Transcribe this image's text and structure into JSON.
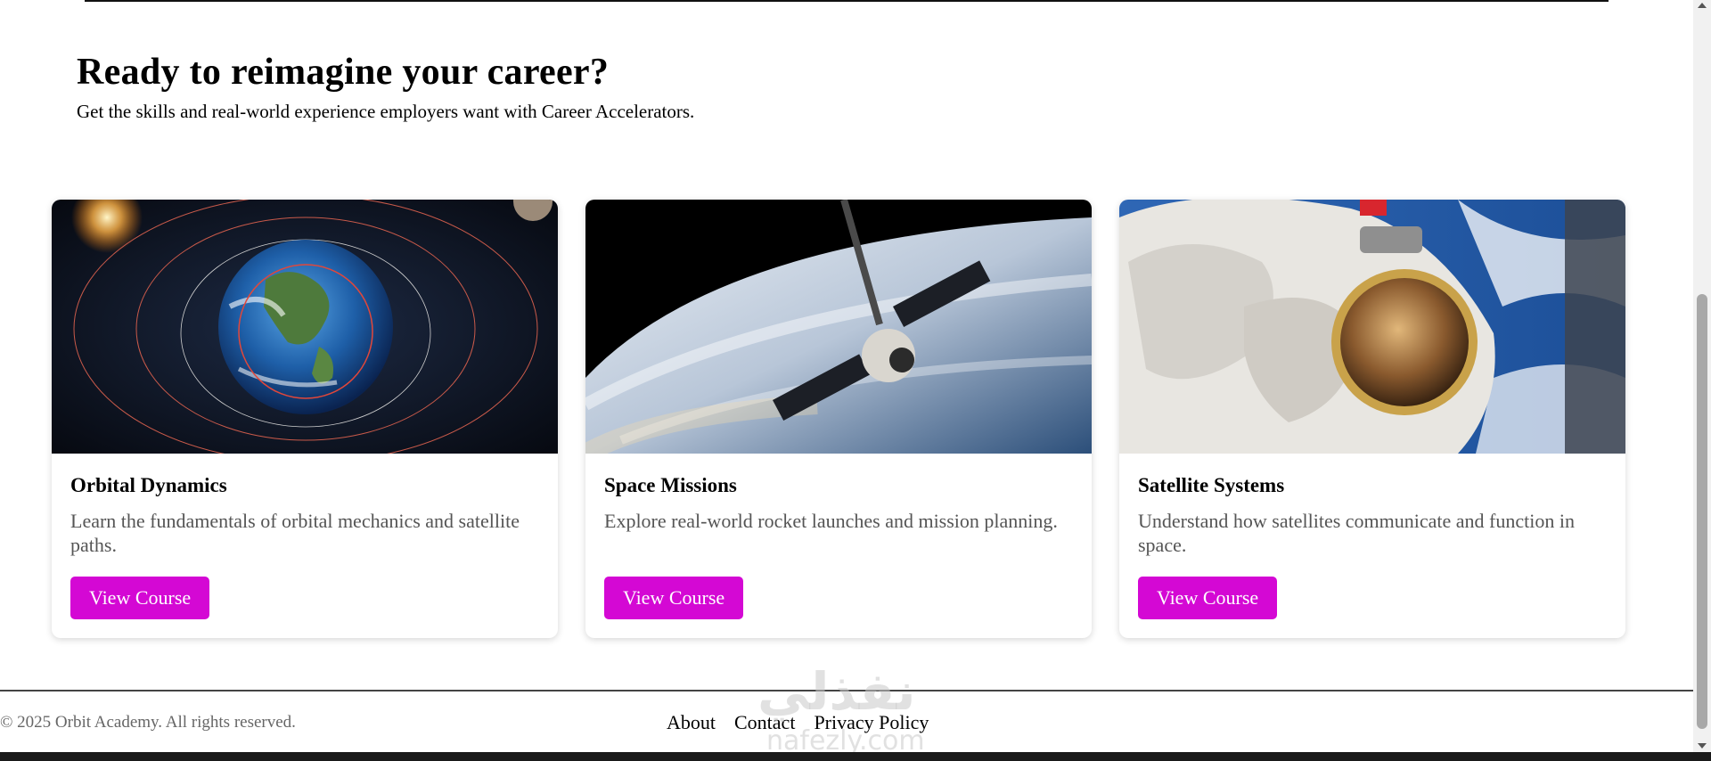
{
  "hero": {
    "title": "Ready to reimagine your career?",
    "subtitle": "Get the skills and real-world experience employers want with Career Accelerators."
  },
  "courses": [
    {
      "title": "Orbital Dynamics",
      "description": "Learn the fundamentals of orbital mechanics and satellite paths.",
      "button": "View Course",
      "image": "earth-orbits-image"
    },
    {
      "title": "Space Missions",
      "description": "Explore real-world rocket launches and mission planning.",
      "button": "View Course",
      "image": "spacecraft-over-earth-image"
    },
    {
      "title": "Satellite Systems",
      "description": "Understand how satellites communicate and function in space.",
      "button": "View Course",
      "image": "astronaut-spacewalk-image"
    }
  ],
  "footer": {
    "copyright": "© 2025 Orbit Academy. All rights reserved.",
    "links": [
      "About",
      "Contact",
      "Privacy Policy"
    ]
  },
  "watermark": {
    "arabic": "نفذلي",
    "latin": "nafezly.com"
  },
  "colors": {
    "accent": "#d408d4",
    "text": "#000000",
    "muted": "#555555"
  }
}
